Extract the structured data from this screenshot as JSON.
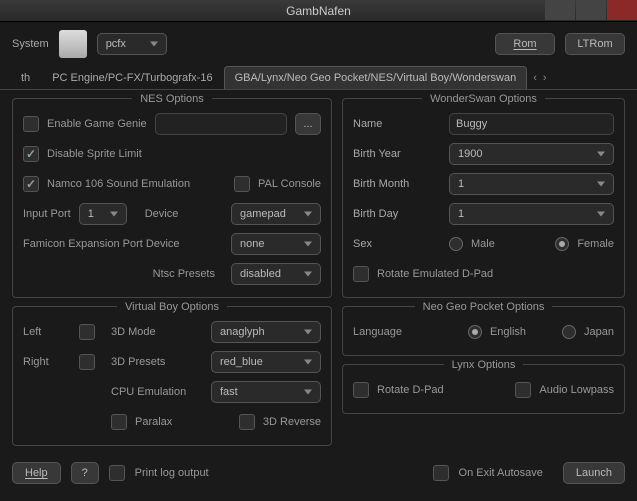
{
  "window": {
    "title": "GambNafen"
  },
  "top": {
    "system_label": "System",
    "system_select": "pcfx",
    "rom_btn": "Rom",
    "ltrom_btn": "LTRom"
  },
  "tabs": {
    "left": "th",
    "mid": "PC Engine/PC-FX/Turbografx-16",
    "active": "GBA/Lynx/Neo Geo Pocket/NES/Virtual Boy/Wonderswan"
  },
  "nes": {
    "legend": "NES Options",
    "enable_game_genie": "Enable Game Genie",
    "disable_sprite_limit": "Disable Sprite Limit",
    "namco": "Namco 106 Sound Emulation",
    "pal": "PAL Console",
    "input_port": "Input Port",
    "input_port_val": "1",
    "device": "Device",
    "device_val": "gamepad",
    "fep": "Famicon Expansion Port Device",
    "fep_val": "none",
    "ntsc": "Ntsc Presets",
    "ntsc_val": "disabled",
    "browse": "..."
  },
  "vb": {
    "legend": "Virtual Boy Options",
    "left": "Left",
    "right": "Right",
    "mode3d": "3D Mode",
    "mode3d_val": "anaglyph",
    "presets3d": "3D Presets",
    "presets3d_val": "red_blue",
    "cpu": "CPU Emulation",
    "cpu_val": "fast",
    "paralax": "Paralax",
    "reverse3d": "3D Reverse"
  },
  "ws": {
    "legend": "WonderSwan Options",
    "name": "Name",
    "name_val": "Buggy",
    "byear": "Birth Year",
    "byear_val": "1900",
    "bmonth": "Birth Month",
    "bmonth_val": "1",
    "bday": "Birth Day",
    "bday_val": "1",
    "sex": "Sex",
    "male": "Male",
    "female": "Female",
    "rotate": "Rotate Emulated D-Pad"
  },
  "ngp": {
    "legend": "Neo Geo Pocket Options",
    "language": "Language",
    "english": "English",
    "japan": "Japan"
  },
  "lynx": {
    "legend": "Lynx Options",
    "rotate": "Rotate D-Pad",
    "lowpass": "Audio Lowpass"
  },
  "bottom": {
    "help": "Help",
    "q": "?",
    "printlog": "Print log output",
    "autosave": "On Exit Autosave",
    "launch": "Launch"
  }
}
